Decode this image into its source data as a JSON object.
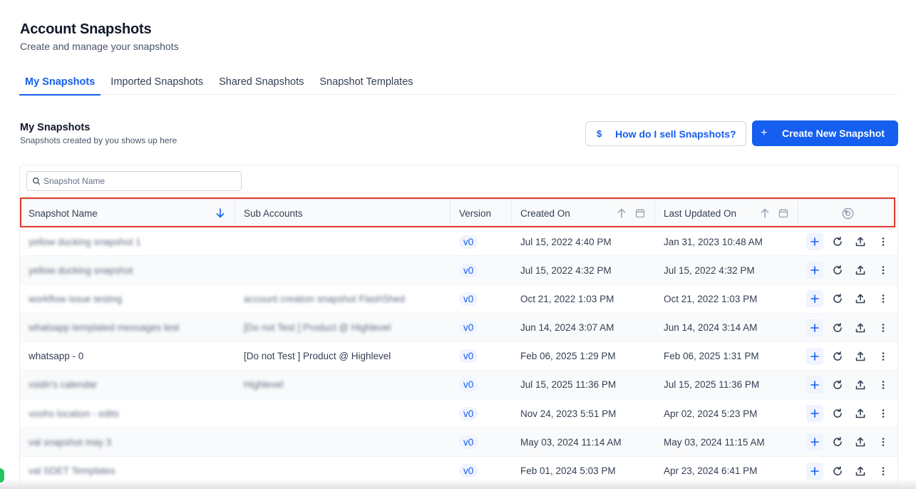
{
  "header": {
    "title": "Account Snapshots",
    "subtitle": "Create and manage your snapshots"
  },
  "tabs": [
    {
      "label": "My Snapshots",
      "active": true
    },
    {
      "label": "Imported Snapshots",
      "active": false
    },
    {
      "label": "Shared Snapshots",
      "active": false
    },
    {
      "label": "Snapshot Templates",
      "active": false
    }
  ],
  "section": {
    "title": "My Snapshots",
    "subtitle": "Snapshots created by you shows up here"
  },
  "buttons": {
    "help_icon": "$",
    "help_label": "How do I sell Snapshots?",
    "create_icon": "+",
    "create_label": "Create New Snapshot"
  },
  "search": {
    "placeholder": "Snapshot Name",
    "value": ""
  },
  "table": {
    "columns": {
      "name": "Snapshot Name",
      "sub_accounts": "Sub Accounts",
      "version": "Version",
      "created": "Created On",
      "updated": "Last Updated On"
    },
    "rows": [
      {
        "name": "yellow ducking snapshot 1",
        "sub": "",
        "version": "v0",
        "created": "Jul 15, 2022 4:40 PM",
        "updated": "Jan 31, 2023 10:48 AM",
        "blurred": true
      },
      {
        "name": "yellow ducking snapshot",
        "sub": "",
        "version": "v0",
        "created": "Jul 15, 2022 4:32 PM",
        "updated": "Jul 15, 2022 4:32 PM",
        "blurred": true
      },
      {
        "name": "workflow issue testing",
        "sub": "account creation snapshot FlashShed",
        "version": "v0",
        "created": "Oct 21, 2022 1:03 PM",
        "updated": "Oct 21, 2022 1:03 PM",
        "blurred": true
      },
      {
        "name": "whatsapp templated messages test",
        "sub": "[Do not Test ] Product @ Highlevel",
        "version": "v0",
        "created": "Jun 14, 2024 3:07 AM",
        "updated": "Jun 14, 2024 3:14 AM",
        "blurred": true
      },
      {
        "name": "whatsapp - 0",
        "sub": "[Do not Test ] Product @ Highlevel",
        "version": "v0",
        "created": "Feb 06, 2025 1:29 PM",
        "updated": "Feb 06, 2025 1:31 PM",
        "blurred": false
      },
      {
        "name": "vsidn's calendar",
        "sub": "Highlevel",
        "version": "v0",
        "created": "Jul 15, 2025 11:36 PM",
        "updated": "Jul 15, 2025 11:36 PM",
        "blurred": true
      },
      {
        "name": "voohs location - edits",
        "sub": "",
        "version": "v0",
        "created": "Nov 24, 2023 5:51 PM",
        "updated": "Apr 02, 2024 5:23 PM",
        "blurred": true
      },
      {
        "name": "val snapshot may 3",
        "sub": "",
        "version": "v0",
        "created": "May 03, 2024 11:14 AM",
        "updated": "May 03, 2024 11:15 AM",
        "blurred": true
      },
      {
        "name": "val SDET Templates",
        "sub": "",
        "version": "v0",
        "created": "Feb 01, 2024 5:03 PM",
        "updated": "Apr 23, 2024 6:41 PM",
        "blurred": true
      }
    ]
  },
  "colors": {
    "accent": "#155eef",
    "highlight": "#e03a2f"
  },
  "icons": [
    "search-icon",
    "sort-desc-icon",
    "sort-asc-icon",
    "calendar-icon",
    "settings-icon",
    "add-icon",
    "refresh-icon",
    "upload-icon",
    "more-vertical-icon"
  ]
}
